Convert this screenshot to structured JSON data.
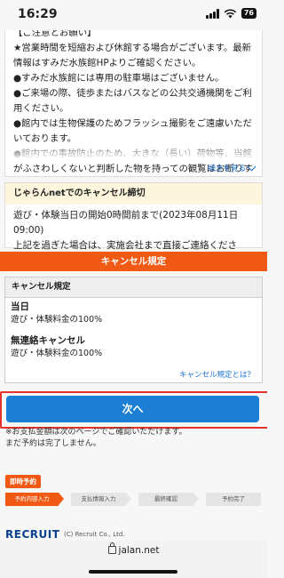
{
  "status_bar": {
    "time": "16:29",
    "battery": "76"
  },
  "notice": {
    "lines": [
      "【ご注意とお願い】",
      "★営業時間を短縮および休館する場合がございます。最新情報はすみだ水族館HPよりご確認ください。",
      "●すみだ水族館には専用の駐車場はございません。",
      "●ご来場の際、徒歩またはバスなどの公共交通機関をご利用ください。",
      "●館内では生物保護のためフラッシュ撮影をご遠慮いただいております。",
      "●館内での事故防止のため、大きな（長い）荷物等、当館がふさわしくないと判断した物を持っての観覧はお断りす"
    ],
    "more_label": "続きを見る"
  },
  "deadline": {
    "title": "じゃらんnetでのキャンセル締切",
    "line1": "遊び・体験当日の開始0時間前まで(2023年08月11日 09:00)",
    "line2": "上記を過ぎた場合は、実施会社まで直接ご連絡ください。"
  },
  "policy_section_title": "キャンセル規定",
  "policy": {
    "header": "キャンセル規定",
    "items": [
      {
        "title": "当日",
        "desc": "遊び・体験料金の100%"
      },
      {
        "title": "無連絡キャンセル",
        "desc": "遊び・体験料金の100%"
      }
    ],
    "link": "キャンセル規定とは？"
  },
  "next_button": "次へ",
  "payment_note": {
    "line1": "※お支払金額は次のページでご確認いただけます。",
    "line2": "まだ予約は完了しません。"
  },
  "instant_badge": "即時予約",
  "steps": [
    "予約内容入力",
    "支払情報入力",
    "最終確認",
    "予約完了"
  ],
  "footer": {
    "logo": "RECRUIT",
    "copyright": "(C) Recruit Co., Ltd."
  },
  "browser": {
    "url": "jalan.net"
  },
  "colors": {
    "accent": "#f05a14",
    "button": "#1c7fd3",
    "link": "#1a73d9",
    "highlight": "#e5322d"
  }
}
